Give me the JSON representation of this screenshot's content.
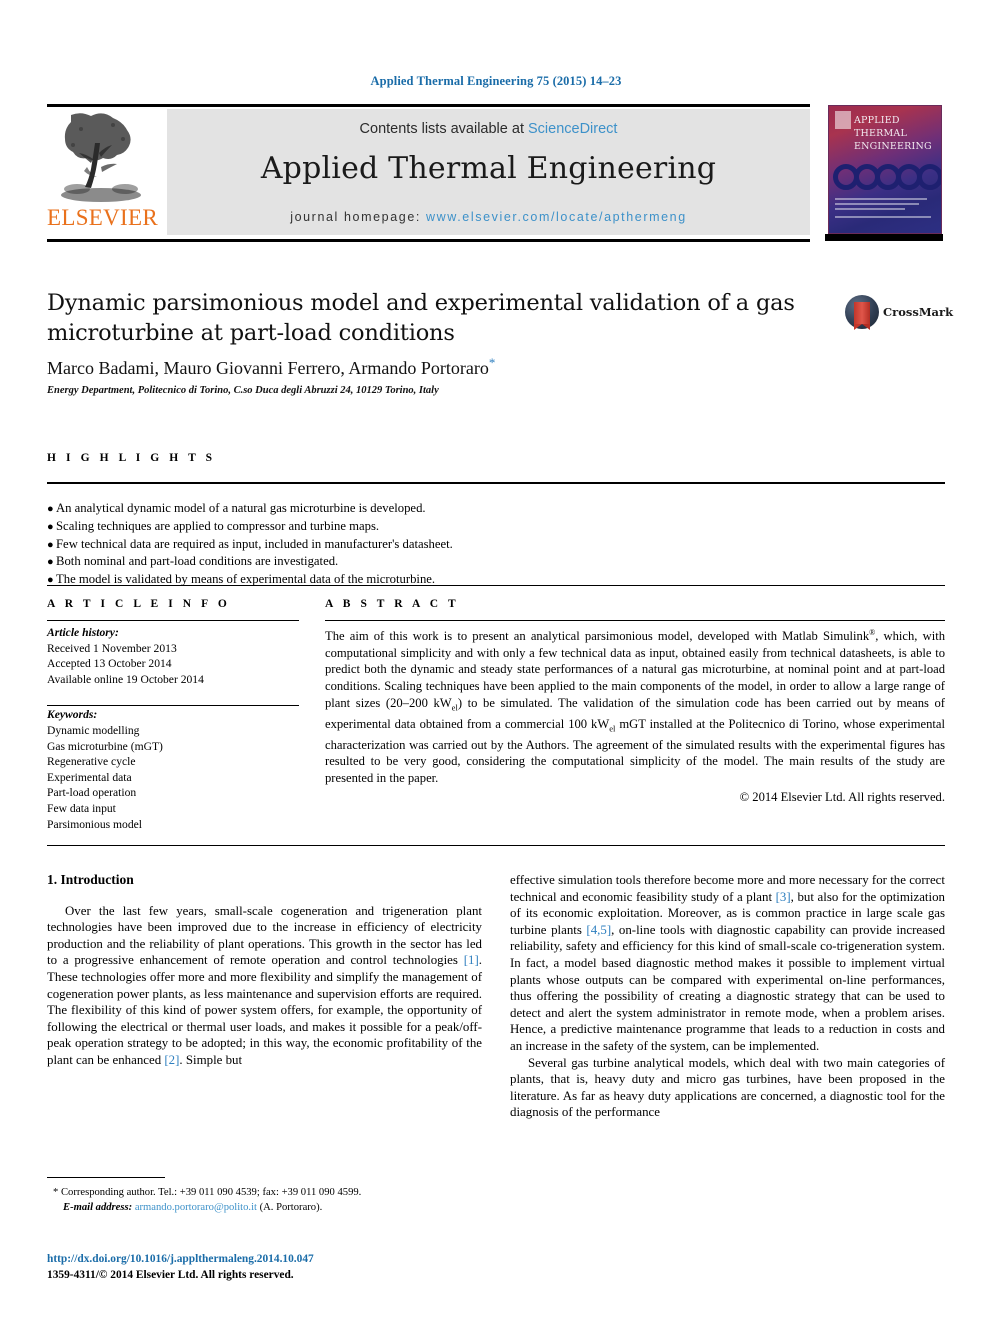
{
  "running_head": "Applied Thermal Engineering 75 (2015) 14–23",
  "masthead": {
    "contents_prefix": "Contents lists available at ",
    "sciencedirect": "ScienceDirect",
    "journal_title": "Applied Thermal Engineering",
    "homepage_label": "journal homepage: ",
    "homepage_url": "www.elsevier.com/locate/apthermeng",
    "publisher": "ELSEVIER",
    "link_color": "#3d91c9",
    "publisher_color": "#E9711C"
  },
  "cover": {
    "line1": "APPLIED",
    "line2": "THERMAL",
    "line3": "ENGINEERING"
  },
  "article": {
    "title": "Dynamic parsimonious model and experimental validation of a gas microturbine at part-load conditions",
    "authors": "Marco Badami, Mauro Giovanni Ferrero, Armando Portoraro",
    "corresponding_marker": "*",
    "affiliation": "Energy Department, Politecnico di Torino, C.so Duca degli Abruzzi 24, 10129 Torino, Italy",
    "crossmark_label": "CrossMark"
  },
  "highlights": {
    "label": "H I G H L I G H T S",
    "items": [
      "An analytical dynamic model of a natural gas microturbine is developed.",
      "Scaling techniques are applied to compressor and turbine maps.",
      "Few technical data are required as input, included in manufacturer's datasheet.",
      "Both nominal and part-load conditions are investigated.",
      "The model is validated by means of experimental data of the microturbine."
    ]
  },
  "article_info": {
    "label": "A R T I C L E   I N F O",
    "history_label": "Article history:",
    "history": [
      "Received 1 November 2013",
      "Accepted 13 October 2014",
      "Available online 19 October 2014"
    ],
    "keywords_label": "Keywords:",
    "keywords": [
      "Dynamic modelling",
      "Gas microturbine (mGT)",
      "Regenerative cycle",
      "Experimental data",
      "Part-load operation",
      "Few data input",
      "Parsimonious model"
    ]
  },
  "abstract": {
    "label": "A B S T R A C T",
    "part1": "The aim of this work is to present an analytical parsimonious model, developed with Matlab Simulink",
    "part2": ", which, with computational simplicity and with only a few technical data as input, obtained easily from technical datasheets, is able to predict both the dynamic and steady state performances of a natural gas microturbine, at nominal point and at part-load conditions. Scaling techniques have been applied to the main components of the model, in order to allow a large range of plant sizes (20–200 kW",
    "sub1": "el",
    "part3": ") to be simulated. The validation of the simulation code has been carried out by means of experimental data obtained from a commercial 100 kW",
    "sub2": "el",
    "part4": " mGT installed at the Politecnico di Torino, whose experimental characterization was carried out by the Authors. The agreement of the simulated results with the experimental figures has resulted to be very good, considering the computational simplicity of the model. The main results of the study are presented in the paper.",
    "copyright": "© 2014 Elsevier Ltd. All rights reserved."
  },
  "introduction": {
    "heading": "1. Introduction",
    "left_p1_a": "Over the last few years, small-scale cogeneration and trigeneration plant technologies have been improved due to the increase in efficiency of electricity production and the reliability of plant operations. This growth in the sector has led to a progressive enhancement of remote operation and control technologies ",
    "left_ref1": "[1]",
    "left_p1_b": ". These technologies offer more and more flexibility and simplify the management of cogeneration power plants, as less maintenance and supervision efforts are required. The flexibility of this kind of power system offers, for example, the opportunity of following the electrical or thermal user loads, and makes it possible for a peak/off-peak operation strategy to be adopted; in this way, the economic profitability of the plant can be enhanced ",
    "left_ref2": "[2]",
    "left_p1_c": ". Simple but",
    "right_p1_a": "effective simulation tools therefore become more and more necessary for the correct technical and economic feasibility study of a plant ",
    "right_ref3": "[3]",
    "right_p1_b": ", but also for the optimization of its economic exploitation. Moreover, as is common practice in large scale gas turbine plants ",
    "right_ref45": "[4,5]",
    "right_p1_c": ", on-line tools with diagnostic capability can provide increased reliability, safety and efficiency for this kind of small-scale co-trigeneration system. In fact, a model based diagnostic method makes it possible to implement virtual plants whose outputs can be compared with experimental on-line performances, thus offering the possibility of creating a diagnostic strategy that can be used to detect and alert the system administrator in remote mode, when a problem arises. Hence, a predictive maintenance programme that leads to a reduction in costs and an increase in the safety of the system, can be implemented.",
    "right_p2": "Several gas turbine analytical models, which deal with two main categories of plants, that is, heavy duty and micro gas turbines, have been proposed in the literature. As far as heavy duty applications are concerned, a diagnostic tool for the diagnosis of the performance"
  },
  "footnote": {
    "marker": "*",
    "line1": "Corresponding author. Tel.: +39 011 090 4539; fax: +39 011 090 4599.",
    "email_label": "E-mail address:",
    "email": "armando.portoraro@polito.it",
    "email_suffix": "(A. Portoraro)."
  },
  "footer": {
    "doi": "http://dx.doi.org/10.1016/j.applthermaleng.2014.10.047",
    "issn": "1359-4311/© 2014 Elsevier Ltd. All rights reserved."
  }
}
